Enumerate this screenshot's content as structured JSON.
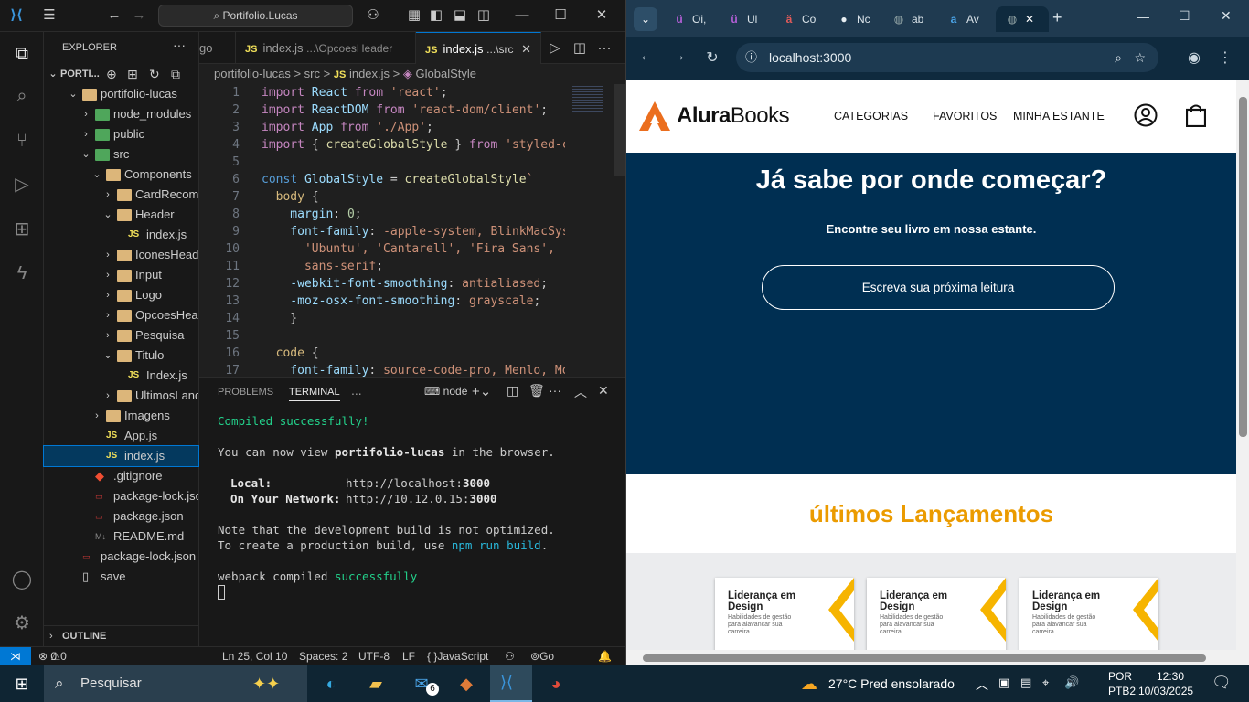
{
  "vscode": {
    "command_center": "Portifolio.Lucas",
    "explorer_title": "EXPLORER",
    "root_label": "PORTI...",
    "tree": [
      {
        "label": "portifolio-lucas",
        "depth": 1,
        "kind": "folder",
        "open": true
      },
      {
        "label": "node_modules",
        "depth": 2,
        "kind": "folder-green"
      },
      {
        "label": "public",
        "depth": 2,
        "kind": "folder-green"
      },
      {
        "label": "src",
        "depth": 2,
        "kind": "folder-green",
        "open": true
      },
      {
        "label": "Components",
        "depth": 3,
        "kind": "folder",
        "open": true
      },
      {
        "label": "CardRecome...",
        "depth": 4,
        "kind": "folder"
      },
      {
        "label": "Header",
        "depth": 4,
        "kind": "folder",
        "open": true
      },
      {
        "label": "index.js",
        "depth": 5,
        "kind": "js"
      },
      {
        "label": "IconesHeader",
        "depth": 4,
        "kind": "folder"
      },
      {
        "label": "Input",
        "depth": 4,
        "kind": "folder"
      },
      {
        "label": "Logo",
        "depth": 4,
        "kind": "folder"
      },
      {
        "label": "OpcoesHeader",
        "depth": 4,
        "kind": "folder"
      },
      {
        "label": "Pesquisa",
        "depth": 4,
        "kind": "folder"
      },
      {
        "label": "Titulo",
        "depth": 4,
        "kind": "folder",
        "open": true
      },
      {
        "label": "Index.js",
        "depth": 5,
        "kind": "js"
      },
      {
        "label": "UltimosLanca...",
        "depth": 4,
        "kind": "folder"
      },
      {
        "label": "Imagens",
        "depth": 3,
        "kind": "folder"
      },
      {
        "label": "App.js",
        "depth": 3,
        "kind": "js"
      },
      {
        "label": "index.js",
        "depth": 3,
        "kind": "js",
        "selected": true
      },
      {
        "label": ".gitignore",
        "depth": 2,
        "kind": "git"
      },
      {
        "label": "package-lock.json",
        "depth": 2,
        "kind": "json"
      },
      {
        "label": "package.json",
        "depth": 2,
        "kind": "json"
      },
      {
        "label": "README.md",
        "depth": 2,
        "kind": "md"
      },
      {
        "label": "package-lock.json",
        "depth": 1,
        "kind": "json"
      },
      {
        "label": "save",
        "depth": 1,
        "kind": "file"
      }
    ],
    "outline_label": "OUTLINE",
    "tabs": [
      {
        "prefix": "",
        "name": "go",
        "hint": ""
      },
      {
        "prefix": "JS",
        "name": "index.js",
        "hint": "...\\OpcoesHeader"
      },
      {
        "prefix": "JS",
        "name": "index.js",
        "hint": "...\\src",
        "active": true
      }
    ],
    "breadcrumb": [
      "portifolio-lucas",
      ">",
      "src",
      ">",
      "JS",
      "index.js",
      ">",
      "GlobalStyle"
    ],
    "code_lines": [
      [
        [
          "kw",
          "import "
        ],
        [
          "v",
          "React "
        ],
        [
          "kw",
          "from "
        ],
        [
          "s",
          "'react'"
        ],
        [
          "",
          "; "
        ]
      ],
      [
        [
          "kw",
          "import "
        ],
        [
          "v",
          "ReactDOM "
        ],
        [
          "kw",
          "from "
        ],
        [
          "s",
          "'react-dom/client'"
        ],
        [
          "",
          ";"
        ]
      ],
      [
        [
          "kw",
          "import "
        ],
        [
          "v",
          "App "
        ],
        [
          "kw",
          "from "
        ],
        [
          "s",
          "'./App'"
        ],
        [
          "",
          ";"
        ]
      ],
      [
        [
          "kw",
          "import "
        ],
        [
          "",
          "{ "
        ],
        [
          "f",
          "createGlobalStyle"
        ],
        [
          "",
          " } "
        ],
        [
          "kw",
          "from "
        ],
        [
          "s",
          "'styled-c"
        ]
      ],
      [
        [
          "",
          ""
        ]
      ],
      [
        [
          "k",
          "const "
        ],
        [
          "v",
          "GlobalStyle "
        ],
        [
          "",
          ""
        ],
        [
          "",
          "= "
        ],
        [
          "f",
          "createGlobalStyle"
        ],
        [
          "s",
          "`"
        ]
      ],
      [
        [
          "p",
          "  body "
        ],
        [
          "",
          "{"
        ]
      ],
      [
        [
          "v",
          "    margin"
        ],
        [
          "",
          ": "
        ],
        [
          "n",
          "0"
        ],
        [
          "",
          ";"
        ]
      ],
      [
        [
          "v",
          "    font-family"
        ],
        [
          "",
          ": "
        ],
        [
          "s",
          "-apple-system, BlinkMacSys"
        ]
      ],
      [
        [
          "s",
          "      'Ubuntu', 'Cantarell', 'Fira Sans', '"
        ]
      ],
      [
        [
          "s",
          "      sans-serif"
        ],
        [
          "",
          ";"
        ]
      ],
      [
        [
          "v",
          "    -webkit-font-smoothing"
        ],
        [
          "",
          ": "
        ],
        [
          "s",
          "antialiased"
        ],
        [
          "",
          ";"
        ]
      ],
      [
        [
          "v",
          "    -moz-osx-font-smoothing"
        ],
        [
          "",
          ": "
        ],
        [
          "s",
          "grayscale"
        ],
        [
          "",
          ";"
        ]
      ],
      [
        [
          "",
          "    }"
        ]
      ],
      [
        [
          "",
          ""
        ]
      ],
      [
        [
          "p",
          "  code "
        ],
        [
          "",
          "{"
        ]
      ],
      [
        [
          "v",
          "    font-family"
        ],
        [
          "",
          ": "
        ],
        [
          "s",
          "source-code-pro, Menlo, Mo"
        ]
      ]
    ],
    "panel_tabs": [
      "PROBLEMS",
      "TERMINAL",
      "..."
    ],
    "terminal_shell": "node",
    "terminal": {
      "compiled": "Compiled successfully!",
      "view_pre": "You can now view ",
      "view_app": "portifolio-lucas",
      "view_post": " in the browser.",
      "local_label": "Local:",
      "local_url_pre": "http://localhost:",
      "local_port": "3000",
      "network_label": "On Your Network:",
      "network_url_pre": "http://10.12.0.15:",
      "network_port": "3000",
      "note1": "Note that the development build is not optimized.",
      "note2_pre": "To create a production build, use ",
      "note2_cmd": "npm run build",
      "note2_post": ".",
      "webpack_pre": "webpack compiled ",
      "webpack_ok": "successfully"
    },
    "status": {
      "errors": "0",
      "warnings": "0",
      "position": "Ln 25, Col 10",
      "spaces": "Spaces: 2",
      "encoding": "UTF-8",
      "eol": "LF",
      "language": "JavaScript",
      "golive": "Go Live"
    }
  },
  "chrome": {
    "tabs": [
      {
        "icon": "ŭ",
        "label": "Oi,"
      },
      {
        "icon": "ŭ",
        "label": "Ul"
      },
      {
        "icon": "ă",
        "label": "Co"
      },
      {
        "icon": "●",
        "label": "Nc"
      },
      {
        "icon": "◍",
        "label": "ab"
      },
      {
        "icon": "a",
        "label": "Av"
      }
    ],
    "url": "localhost:3000"
  },
  "site": {
    "logo_bold": "Alura",
    "logo_rest": "Books",
    "nav": [
      "CATEGORIAS",
      "FAVORITOS",
      "MINHA ESTANTE"
    ],
    "hero_title": "Já sabe por onde começar?",
    "hero_subtitle": "Encontre seu livro em nossa estante.",
    "search_placeholder": "Escreva sua próxima leitura",
    "releases_title": "últimos Lançamentos",
    "book_title": "Liderança em Design",
    "book_subtitle": "Habilidades de gestão para alavancar sua carreira"
  },
  "taskbar": {
    "search": "Pesquisar",
    "mail_badge": "6",
    "weather": "27°C  Pred ensolarado",
    "lang1": "POR",
    "lang2": "PTB2",
    "time": "12:30",
    "date": "10/03/2025"
  },
  "colors": {
    "accent": "#0078d4",
    "hero_bg": "#002f52",
    "release_orange": "#eb9b00",
    "logo_orange": "#eb9b00"
  }
}
